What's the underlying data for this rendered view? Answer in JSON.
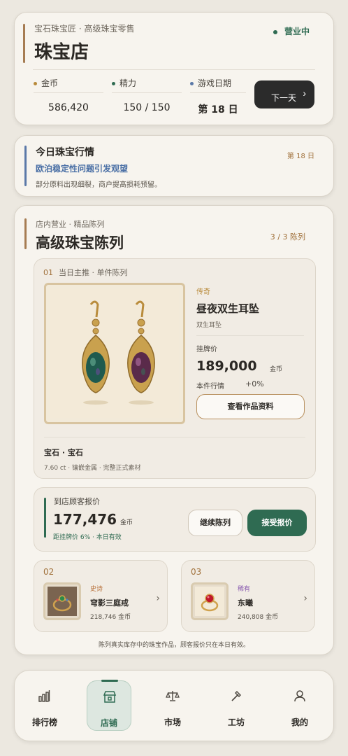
{
  "header": {
    "subtitle": "宝石珠宝匠 · 高级珠宝零售",
    "title": "珠宝店",
    "status": "营业中",
    "stats": {
      "gold": {
        "label": "金币",
        "value": "586,420",
        "color": "#b88a3a"
      },
      "energy": {
        "label": "精力",
        "value": "150 / 150",
        "color": "#2f6b52"
      },
      "date": {
        "label": "游戏日期",
        "value": "第 18 日",
        "color": "#5b79a8"
      }
    },
    "next_day_label": "下一天"
  },
  "market": {
    "title": "今日珠宝行情",
    "day": "第 18 日",
    "headline": "欧泊稳定性问题引发观望",
    "description": "部分原料出现细裂，商户提高损耗预留。"
  },
  "showcase": {
    "subtitle": "店内营业 · 精品陈列",
    "title": "高级珠宝陈列",
    "count": "3 / 3 陈列",
    "feature": {
      "number": "01",
      "label": "当日主推 · 单件陈列",
      "rarity": "传奇",
      "name": "昼夜双生耳坠",
      "type": "双生耳坠",
      "price_label": "挂牌价",
      "price": "189,000",
      "price_unit": "金币",
      "market_label": "本件行情",
      "market_value": "+0%",
      "view_button": "查看作品资料",
      "gems": "宝石 · 宝石",
      "spec": "7.60 ct · 镶嵌金属 · 完整正式素材"
    },
    "offer": {
      "label": "到店顾客报价",
      "value": "177,476",
      "unit": "金币",
      "note": "距挂牌价 6% · 本日有效",
      "continue_button": "继续陈列",
      "accept_button": "接受报价"
    },
    "items": [
      {
        "number": "02",
        "rarity": "史诗",
        "rarity_color": "#b8703a",
        "name": "穹影三庭戒",
        "price": "218,746 金币"
      },
      {
        "number": "03",
        "rarity": "稀有",
        "rarity_color": "#8a5bb0",
        "name": "东曦",
        "price": "240,808 金币"
      }
    ],
    "footnote": "陈列真实库存中的珠宝作品，顾客报价只在本日有效。"
  },
  "nav": [
    {
      "label": "排行榜",
      "icon": "bar-chart-icon"
    },
    {
      "label": "店铺",
      "icon": "shop-icon",
      "active": true
    },
    {
      "label": "市场",
      "icon": "scale-icon"
    },
    {
      "label": "工坊",
      "icon": "hammer-icon"
    },
    {
      "label": "我的",
      "icon": "user-icon"
    }
  ]
}
